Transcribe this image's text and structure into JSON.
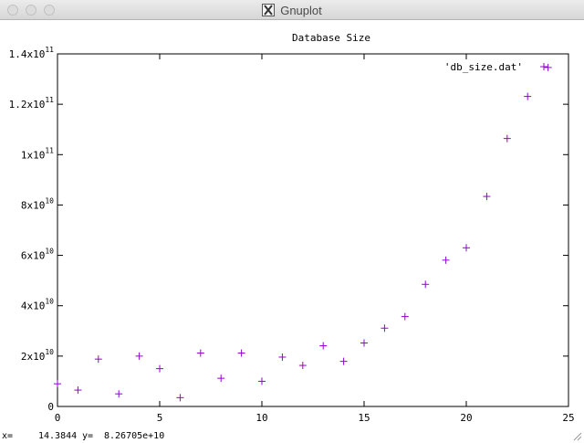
{
  "window": {
    "title": "Gnuplot",
    "icon": "x11-icon",
    "controls": [
      "close-icon",
      "minimize-icon",
      "zoom-icon"
    ]
  },
  "chart_data": {
    "type": "scatter",
    "title": "Database Size",
    "xlabel": "",
    "ylabel": "",
    "xlim": [
      0,
      25
    ],
    "ylim": [
      0,
      140000000000
    ],
    "x_ticks": [
      "0",
      "5",
      "10",
      "15",
      "20",
      "25"
    ],
    "x_tick_values": [
      0,
      5,
      10,
      15,
      20,
      25
    ],
    "y_ticks": [
      {
        "mantissa": "0",
        "exp": ""
      },
      {
        "mantissa": "2x10",
        "exp": "10"
      },
      {
        "mantissa": "4x10",
        "exp": "10"
      },
      {
        "mantissa": "6x10",
        "exp": "10"
      },
      {
        "mantissa": "8x10",
        "exp": "10"
      },
      {
        "mantissa": "1x10",
        "exp": "11"
      },
      {
        "mantissa": "1.2x10",
        "exp": "11"
      },
      {
        "mantissa": "1.4x10",
        "exp": "11"
      }
    ],
    "y_tick_values": [
      0,
      20000000000,
      40000000000,
      60000000000,
      80000000000,
      100000000000,
      120000000000,
      140000000000
    ],
    "grid": false,
    "legend_position": "top-right",
    "marker": "plus",
    "color": "#9400d3",
    "series": [
      {
        "name": "'db_size.dat'",
        "x": [
          0,
          1,
          2,
          3,
          4,
          5,
          6,
          7,
          8,
          9,
          10,
          11,
          12,
          13,
          14,
          15,
          16,
          17,
          18,
          19,
          20,
          21,
          22,
          23,
          24
        ],
        "y": [
          9000000000,
          6500000000,
          18800000000,
          5000000000,
          20000000000,
          15000000000,
          3500000000,
          21200000000,
          11200000000,
          21200000000,
          10000000000,
          19600000000,
          16300000000,
          24100000000,
          17900000000,
          25200000000,
          31100000000,
          35700000000,
          48500000000,
          58100000000,
          63000000000,
          83400000000,
          106400000000,
          123100000000,
          134600000000
        ]
      }
    ]
  },
  "status": {
    "x_label": "x=",
    "x_value": "14.3844",
    "y_label": "y=",
    "y_value": "8.26705e+10"
  }
}
